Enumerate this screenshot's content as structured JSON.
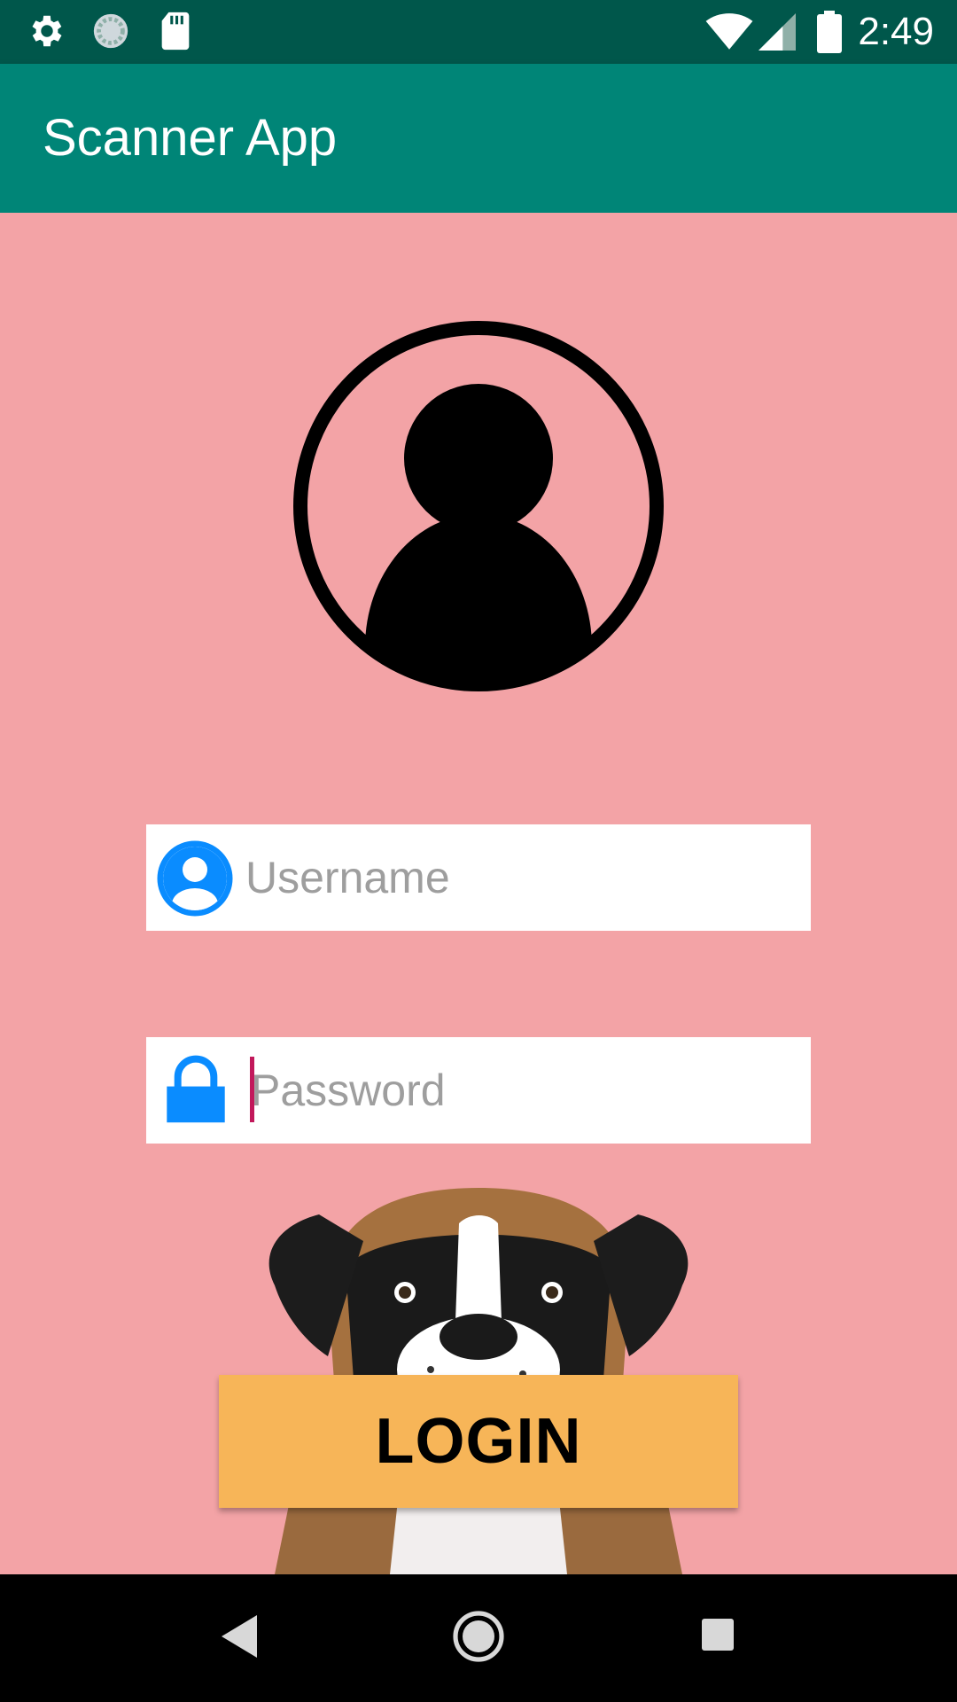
{
  "status_bar": {
    "time": "2:49",
    "left_icons": [
      "settings-icon",
      "sync-icon",
      "sd-card-icon"
    ],
    "right_icons": [
      "wifi-icon",
      "cell-signal-icon",
      "battery-icon"
    ]
  },
  "app_bar": {
    "title": "Scanner App",
    "color": "#008577"
  },
  "login_form": {
    "avatar_icon": "user-profile-icon",
    "username": {
      "placeholder": "Username",
      "value": "",
      "icon": "user-icon"
    },
    "password": {
      "placeholder": "Password",
      "value": "",
      "icon": "lock-icon",
      "focused": true
    },
    "background_image": "boxer-dog-illustration",
    "login_label": "LOGIN",
    "login_color": "#f7b558"
  },
  "nav_bar": {
    "buttons": [
      "back-icon",
      "home-icon",
      "recents-icon"
    ]
  },
  "colors": {
    "background": "#f3a3a6",
    "status_bar": "#00574b",
    "accent_icon": "#0a8cff",
    "cursor": "#c2185b"
  }
}
